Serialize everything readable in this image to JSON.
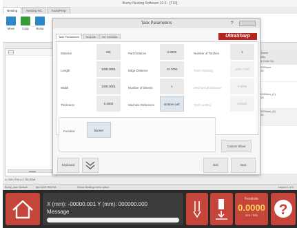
{
  "window": {
    "title": "Burny Nesting Software 10.0 - [T10]"
  },
  "tabs": [
    "Nesting",
    "Nesting NC",
    "Tools/Prep"
  ],
  "toolbar": {
    "buttons": [
      {
        "label": "Move",
        "icon": "move-icon",
        "color": "#2f86c9"
      },
      {
        "label": "Copy",
        "icon": "copy-icon",
        "color": "#3a9a3a"
      },
      {
        "label": "Bump",
        "icon": "bump-icon",
        "color": "#2f86c9"
      }
    ]
  },
  "dialog": {
    "title": "Task Parameters",
    "help": "?",
    "tabs": [
      "Task Parameters",
      "Toolpath",
      "NC Simulate"
    ],
    "brand": "UltraSharp",
    "fields": {
      "material": {
        "label": "Material",
        "value": "MC"
      },
      "length": {
        "label": "Length",
        "value": "1000.0001"
      },
      "width": {
        "label": "Width",
        "value": "1000.0001"
      },
      "thickness": {
        "label": "Thickness",
        "value": "0.0000"
      },
      "part_distance": {
        "label": "Part Distance",
        "value": "2.0000"
      },
      "edge_distance": {
        "label": "Edge Distance",
        "value": "12.7000"
      },
      "number_of_sheets": {
        "label": "Number of Sheets",
        "value": "1"
      },
      "machine_reference": {
        "label": "Machine Reference",
        "value": "Bottom Left"
      },
      "number_of_torches": {
        "label": "Number of Torches",
        "value": "1"
      },
      "torch_spacing": {
        "label": "Torch Spacing",
        "value": "1000.7200"
      },
      "mechanical_distance": {
        "label": "Mechanical Distance",
        "value": "0.0000"
      },
      "torch_setting": {
        "label": "Torch setting",
        "value": "Default"
      }
    },
    "function": {
      "label": "Function",
      "value": "Burner"
    },
    "custom_sheet": "Custom Sheet",
    "keyboard": "Keyboard",
    "exit": "Exit",
    "next": "Next"
  },
  "right_panel": {
    "header": [
      "Part Name",
      "Quantity",
      "Week Order No."
    ],
    "items": [
      {
        "name": "1X-1DXNone",
        "qty": "0 of 50"
      },
      {
        "name": "WXXX4Nons_(1)",
        "qty": "0 of 50"
      },
      {
        "name": "RBXXDNone_(4)",
        "qty": "0 of 50"
      }
    ]
  },
  "coord_line": "x= 205.1790 y=1758.8558",
  "status": {
    "left": "Burny_user Default",
    "mid": "3pc 6400 INCH/A",
    "hint": "Select Nesting menu option",
    "right": "Layout 1 of 1"
  },
  "bottom": {
    "coords": "X (mm): -00000.001     Y (mm): 000000.000",
    "message": "Message",
    "feedrate_label": "Feedrate",
    "feedrate_value": "0.0000",
    "feedrate_unit": "mm / Min",
    "help": "?"
  },
  "colors": {
    "accent_red": "#c5453b",
    "brand_red": "#b5241f",
    "dark_bar": "#2a2a2a",
    "feed_value": "#ffd35a"
  }
}
